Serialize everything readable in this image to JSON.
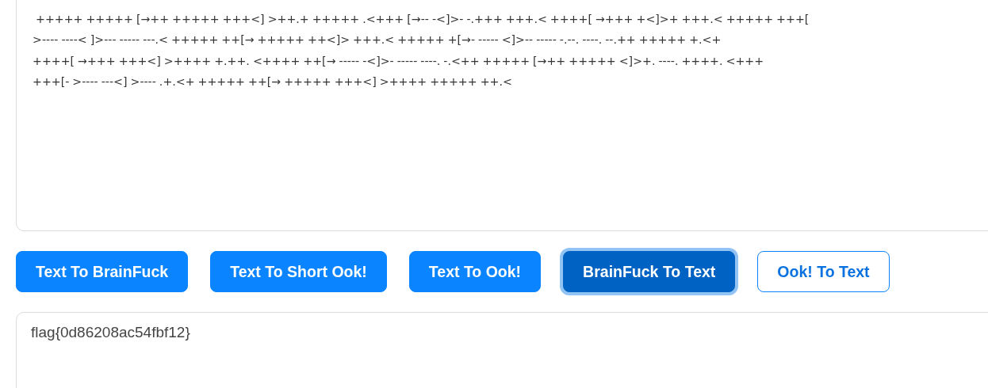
{
  "input": {
    "lines": [
      " +++++ +++++ [→++ +++++ +++<] >++.+ +++++ .<+++ [→-- -<]>- -.+++ +++.< ++++[ →+++ +<]>+ +++.< +++++ +++[",
      ">---- ----< ]>--- ----- ---.< +++++ ++[→ +++++ ++<]> +++.< +++++ +[→- ----- <]>-- ----- -.--. ----. --.++ +++++ +.<+",
      "++++[ →+++ +++<] >++++ +.++. <++++ ++[→ ----- -<]>- ----- ----. -.<++ +++++ [→++ +++++ <]>+. ----. ++++. <+++",
      "+++[- >---- ---<] >---- .+.<+ +++++ ++[→ +++++ +++<] >++++ +++++ ++.<"
    ]
  },
  "buttons": [
    {
      "label": "Text To BrainFuck",
      "kind": "solid",
      "selected": false
    },
    {
      "label": "Text To Short Ook!",
      "kind": "solid",
      "selected": false
    },
    {
      "label": "Text To Ook!",
      "kind": "solid",
      "selected": false
    },
    {
      "label": "BrainFuck To Text",
      "kind": "solid",
      "selected": true
    },
    {
      "label": "Ook! To Text",
      "kind": "outline",
      "selected": false
    }
  ],
  "output": {
    "value": "flag{0d86208ac54fbf12}"
  }
}
